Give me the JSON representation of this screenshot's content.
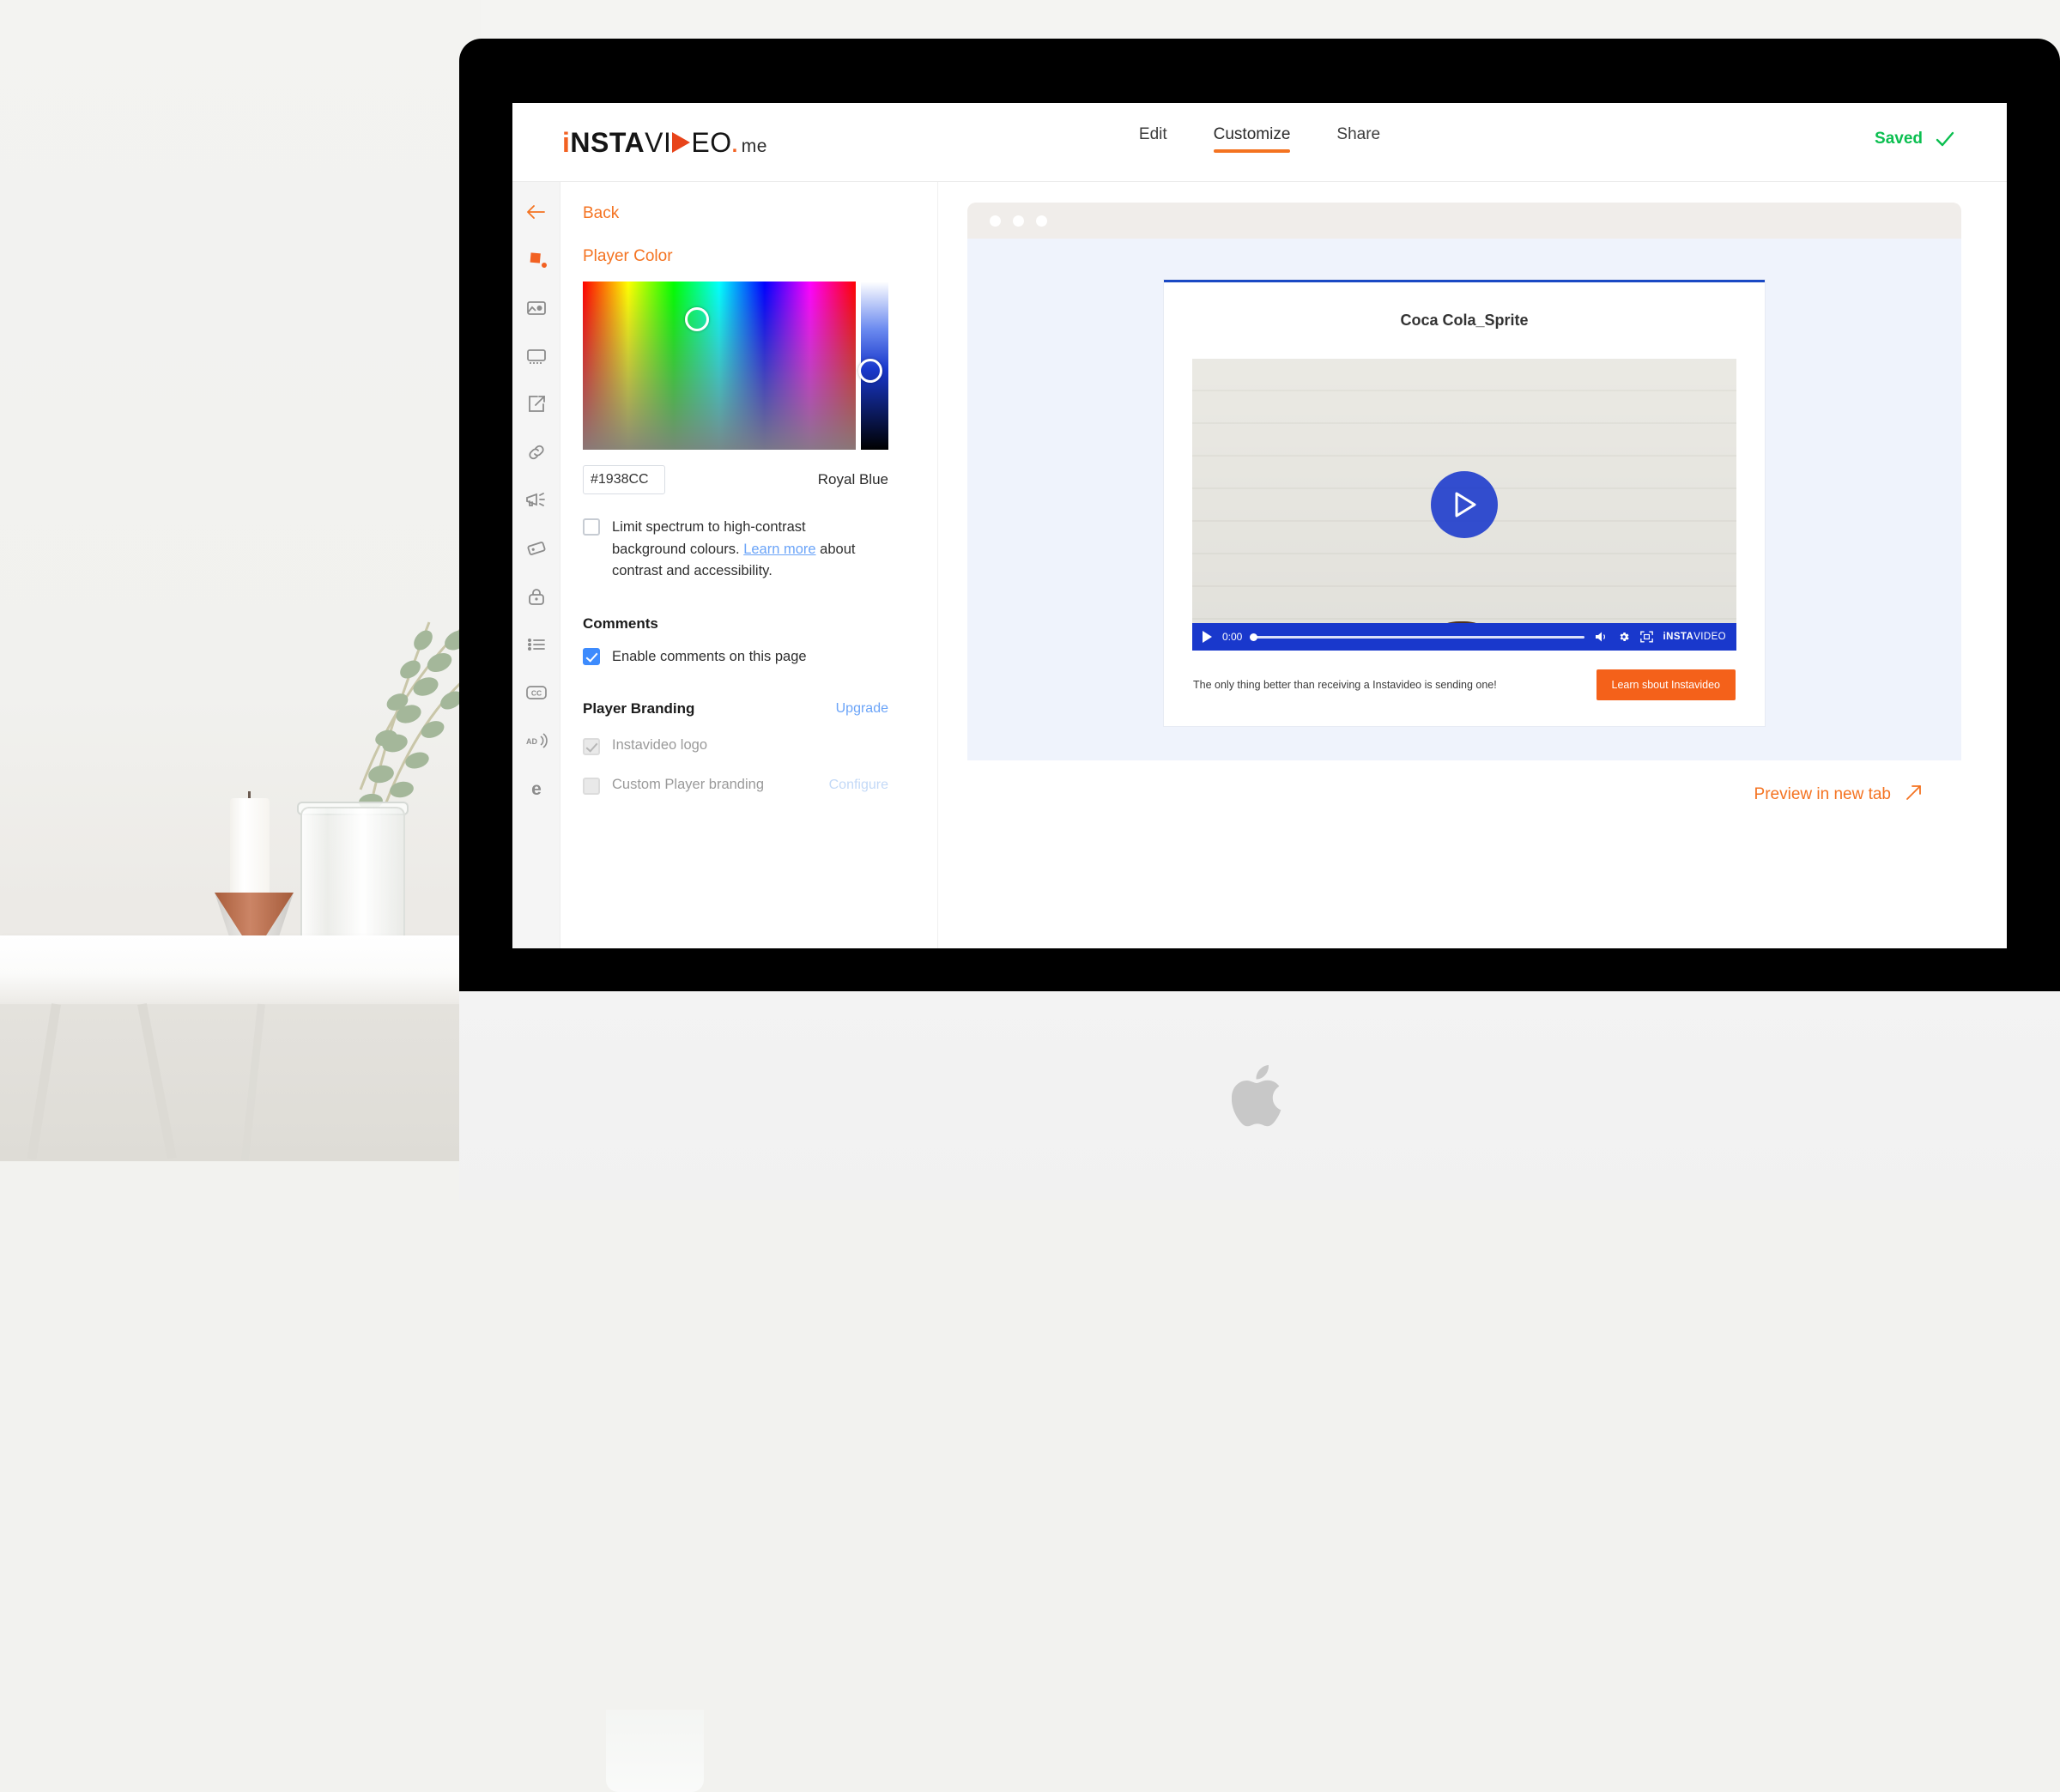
{
  "app": {
    "logo": {
      "part1": "i",
      "part2": "NSTA",
      "part3": "VI",
      "part4": "EO",
      "dot": ".",
      "suffix": "me"
    },
    "tabs": [
      {
        "label": "Edit",
        "active": false
      },
      {
        "label": "Customize",
        "active": true
      },
      {
        "label": "Share",
        "active": false
      }
    ],
    "status": {
      "label": "Saved",
      "icon": "check-icon",
      "color": "#0BBF50"
    }
  },
  "rail": {
    "items": [
      {
        "name": "back-arrow-icon",
        "label": "Back"
      },
      {
        "name": "paint-bucket-icon",
        "label": "Player Color"
      },
      {
        "name": "image-icon",
        "label": "Thumbnail"
      },
      {
        "name": "screen-icon",
        "label": "Player Layout"
      },
      {
        "name": "share-icon",
        "label": "Share"
      },
      {
        "name": "link-icon",
        "label": "Link"
      },
      {
        "name": "megaphone-icon",
        "label": "Call to action"
      },
      {
        "name": "tag-icon",
        "label": "Tags"
      },
      {
        "name": "lock-icon",
        "label": "Privacy"
      },
      {
        "name": "list-icon",
        "label": "Chapters"
      },
      {
        "name": "closed-caption-icon",
        "label": "Captions"
      },
      {
        "name": "audio-description-icon",
        "label": "Audio description"
      },
      {
        "name": "embed-icon",
        "label": "Embed"
      }
    ]
  },
  "panel": {
    "back_label": "Back",
    "title": "Player Color",
    "color": {
      "hex_value": "#1938CC",
      "hex_placeholder": "#1938CC",
      "name": "Royal Blue",
      "accent": "#1938CC"
    },
    "limit_spectrum": {
      "checked": false,
      "text_before": "Limit spectrum to high-contrast background colours. ",
      "link": "Learn more",
      "text_after": " about contrast and accessibility."
    },
    "comments": {
      "heading": "Comments",
      "checkbox_label": "Enable comments on this page",
      "checked": true
    },
    "branding": {
      "heading": "Player Branding",
      "upgrade_label": "Upgrade",
      "rows": [
        {
          "label": "Instavideo logo",
          "checked": true,
          "disabled": true,
          "action": ""
        },
        {
          "label": "Custom Player branding",
          "checked": false,
          "disabled": true,
          "action": "Configure"
        }
      ]
    }
  },
  "preview": {
    "video_title": "Coca Cola_Sprite",
    "player": {
      "current_time": "0:00",
      "brand_bold": "iNSTA",
      "brand_light": "VIDEO",
      "progress_percent": 0
    },
    "cta": {
      "text": "The only thing better than receiving a Instavideo is sending one!",
      "button_label": "Learn sbout Instavideo"
    },
    "preview_link": "Preview in new tab"
  }
}
